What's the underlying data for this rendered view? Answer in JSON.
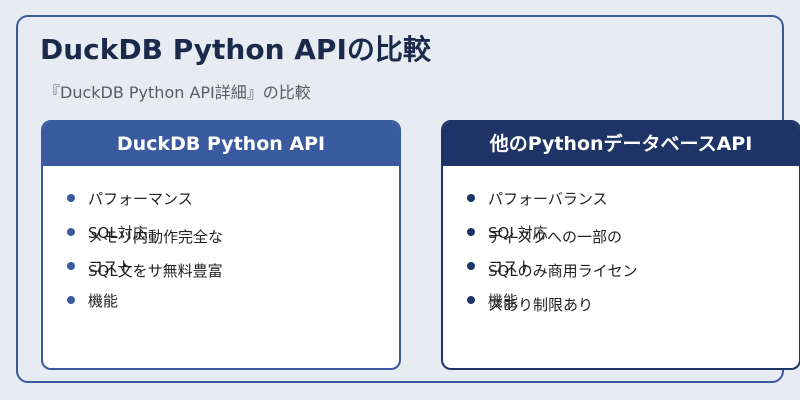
{
  "title": "DuckDB Python APIの比較",
  "subtitle": "『DuckDB Python API詳細』の比較",
  "colors": {
    "background": "#e7ecf2",
    "left_accent": "#3a5aa0",
    "right_accent": "#1f3466"
  },
  "left": {
    "heading": "DuckDB Python API",
    "items": [
      "パフォーマンス",
      "SQL対応",
      "コスト",
      "機能"
    ],
    "details": "メモリ内動作完全なSQL文をサ無料豊富"
  },
  "right": {
    "heading": "他のPythonデータベースAPI",
    "items": [
      "パフォーバランス",
      "SQL対応",
      "コスト",
      "機能"
    ],
    "details": "ディスクへの一部のSQLのみ商用ライセンスあり制限あり"
  }
}
